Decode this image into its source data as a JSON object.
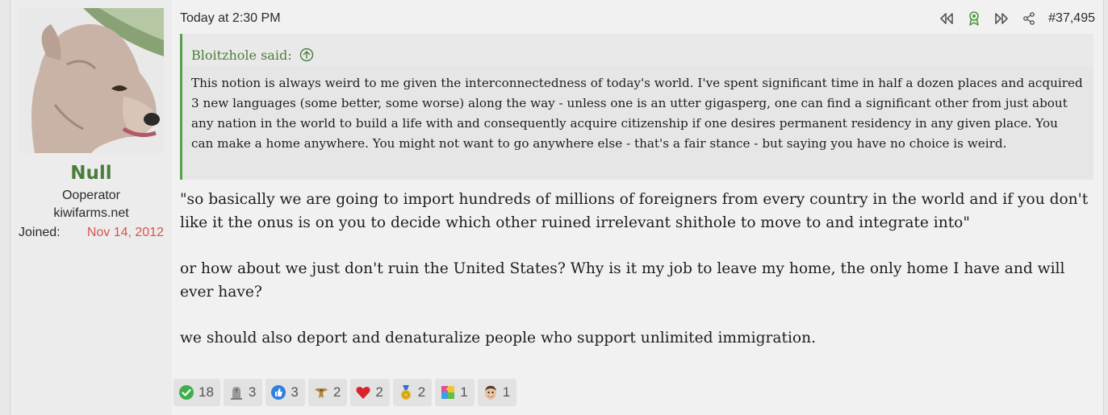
{
  "user": {
    "name": "Null",
    "title": "Ooperator",
    "site": "kiwifarms.net",
    "joined_label": "Joined:",
    "joined_value": "Nov 14, 2012"
  },
  "meta": {
    "timestamp": "Today at 2:30 PM",
    "post_number": "#37,495"
  },
  "quote": {
    "author_line": "Bloitzhole said:",
    "text": "This notion is always weird to me given the interconnectedness of today's world. I've spent significant time in half a dozen places and acquired 3 new languages (some better, some worse) along the way - unless one is an utter gigasperg, one can find a significant other from just about any nation in the world to build a life with and consequently acquire citizenship if one desires permanent residency in any given place. You can make a home anywhere. You might not want to go anywhere else - that's a fair stance - but saying you have no choice is weird."
  },
  "body": [
    "\"so basically we are going to import hundreds of millions of foreigners from every country in the world and if you don't like it the onus is on you to decide which other ruined irrelevant shithole to move to and integrate into\"",
    "or how about we just don't ruin the United States? Why is it my job to leave my home, the only home I have and will ever have?",
    "we should also deport and denaturalize people who support unlimited immigration."
  ],
  "reactions": [
    {
      "icon": "checkmark-icon",
      "count": "18"
    },
    {
      "icon": "tombstone-icon",
      "count": "3"
    },
    {
      "icon": "thumbs-up-icon",
      "count": "3"
    },
    {
      "icon": "eagle-icon",
      "count": "2"
    },
    {
      "icon": "heart-icon",
      "count": "2"
    },
    {
      "icon": "medal-icon",
      "count": "2"
    },
    {
      "icon": "puzzle-icon",
      "count": "1"
    },
    {
      "icon": "face-icon",
      "count": "1"
    }
  ],
  "colors": {
    "username": "#4a7d3a",
    "joined_date": "#d9534f",
    "quote_accent": "#55a049"
  }
}
